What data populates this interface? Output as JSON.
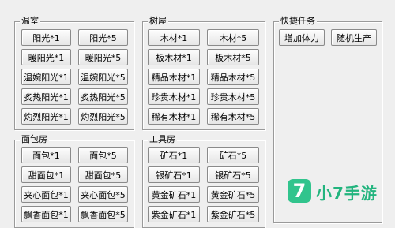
{
  "groups": {
    "wenshi": {
      "title": "温室",
      "buttons": [
        "阳光*1",
        "阳光*5",
        "暖阳光*1",
        "暖阳光*5",
        "温婉阳光*1",
        "温婉阳光*5",
        "炙热阳光*1",
        "炙热阳光*5",
        "灼烈阳光*1",
        "灼烈阳光*5"
      ]
    },
    "shuwu": {
      "title": "树屋",
      "buttons": [
        "木材*1",
        "木材*5",
        "板木材*1",
        "板木材*5",
        "精品木材*1",
        "精品木材*5",
        "珍贵木材*1",
        "珍贵木材*5",
        "稀有木材*1",
        "稀有木材*5"
      ]
    },
    "kuaijie": {
      "title": "快捷任务",
      "buttons": [
        "增加体力",
        "随机生产"
      ]
    },
    "mianbao": {
      "title": "面包房",
      "buttons": [
        "面包*1",
        "面包*5",
        "甜面包*1",
        "甜面包*5",
        "夹心面包*1",
        "夹心面包*5",
        "飘香面包*1",
        "飘香面包*5"
      ]
    },
    "gongju": {
      "title": "工具房",
      "buttons": [
        "矿石*1",
        "矿石*5",
        "银矿石*1",
        "银矿石*5",
        "黄金矿石*1",
        "黄金矿石*5",
        "紫金矿石*1",
        "紫金矿石*5"
      ]
    }
  },
  "watermark": {
    "mark": "7",
    "text": "小7手游",
    "color": "#31c48d"
  }
}
